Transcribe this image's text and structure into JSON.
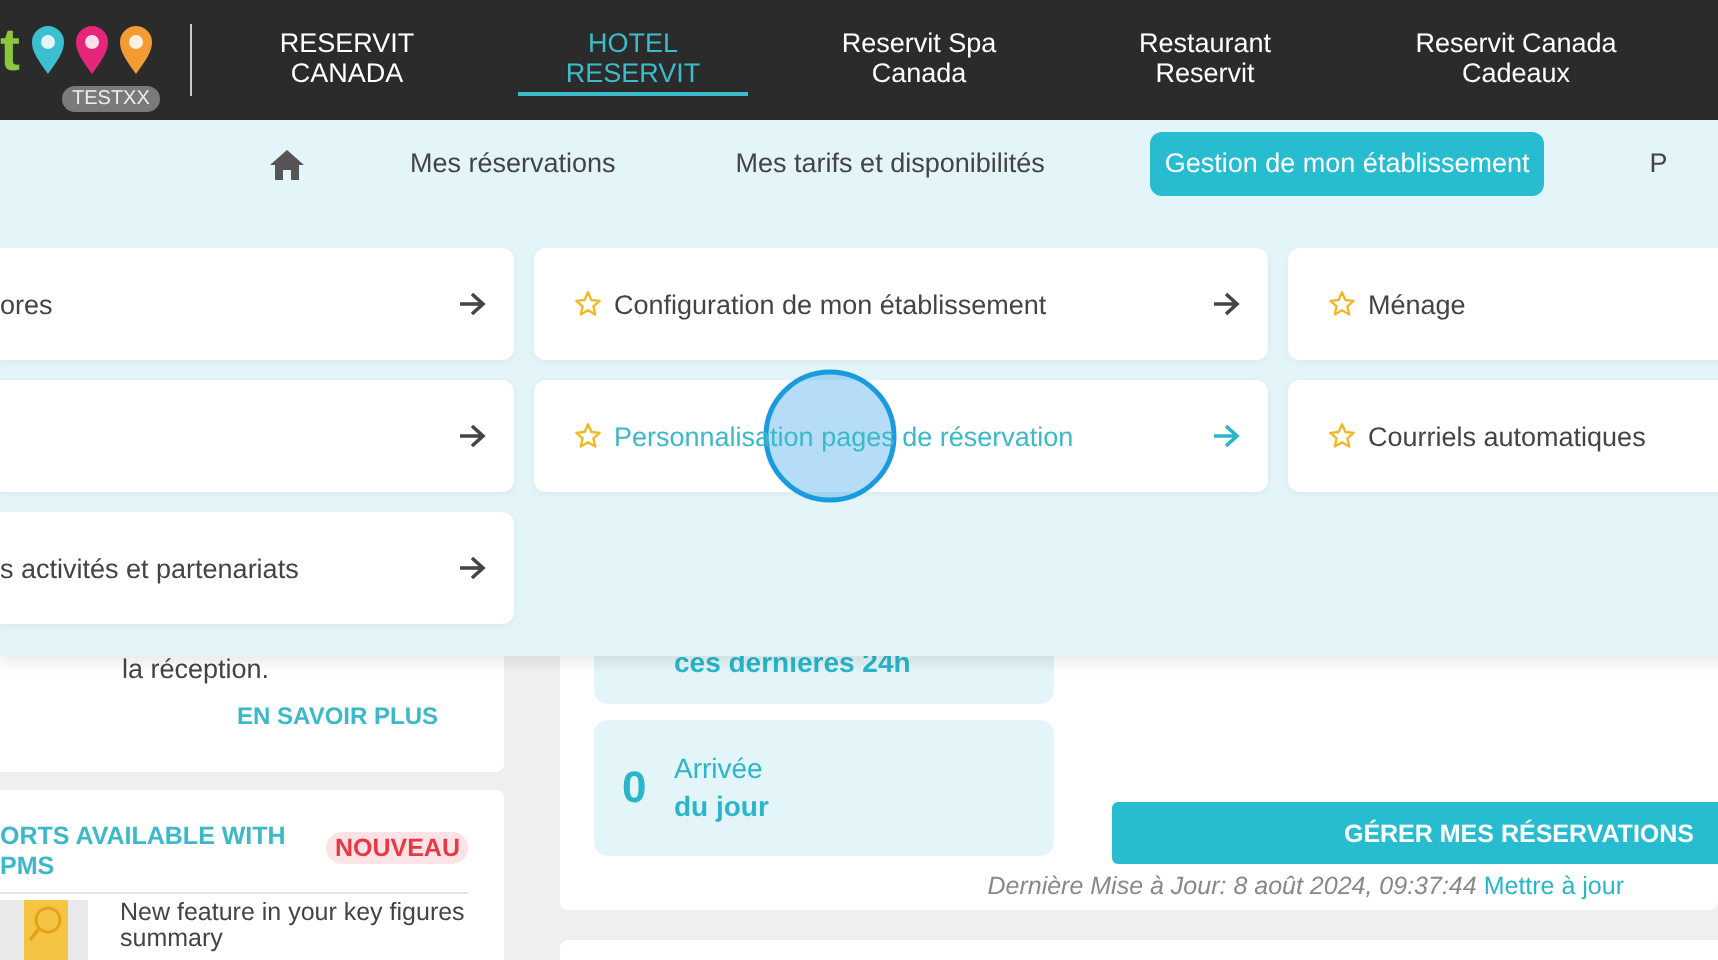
{
  "header": {
    "logo_text": "t",
    "badge": "TESTXX",
    "nav": [
      {
        "label": "RESERVIT\nCANADA",
        "selected": false
      },
      {
        "label": "HOTEL\nRESERVIT",
        "selected": true
      },
      {
        "label": "Reservit Spa\nCanada",
        "selected": false
      },
      {
        "label": "Restaurant\nReservit",
        "selected": false
      },
      {
        "label": "Reservit Canada\nCadeaux",
        "selected": false
      }
    ]
  },
  "subnav": [
    {
      "label": "Mes réservations",
      "selected": false
    },
    {
      "label": "Mes tarifs et disponibilités",
      "selected": false
    },
    {
      "label": "Gestion de mon établissement",
      "selected": true
    },
    {
      "label": "P",
      "selected": false
    }
  ],
  "menu": [
    {
      "label": "ores",
      "starred": false,
      "hovered": false,
      "arrow": true
    },
    {
      "label": "Configuration de mon établissement",
      "starred": true,
      "hovered": false,
      "arrow": true
    },
    {
      "label": "Ménage",
      "starred": true,
      "hovered": false,
      "arrow": false
    },
    {
      "starred": false,
      "hovered": false,
      "arrow": true
    },
    {
      "label": "Personnalisation pages de réservation",
      "starred": true,
      "hovered": true,
      "arrow": true
    },
    {
      "label": "Courriels automatiques",
      "starred": true,
      "hovered": false,
      "arrow": false
    },
    {
      "label": "s activités et partenariats",
      "starred": false,
      "hovered": false,
      "arrow": true
    }
  ],
  "left_cards": {
    "text": "la réception.",
    "link": "EN SAVOIR PLUS",
    "title": "ORTS AVAILABLE WITH\nPMS",
    "badge": "NOUVEAU",
    "body": "New feature in your key figures summary"
  },
  "stats": [
    {
      "label_bold": "ces dernières 24h"
    },
    {
      "value": "0",
      "label": "Arrivée",
      "label_bold": "du jour"
    }
  ],
  "manage_button": "GÉRER MES RÉSERVATIONS",
  "last_update": "Dernière Mise à Jour: 8 août 2024, 09:37:44",
  "refresh_link": "Mettre à jour"
}
